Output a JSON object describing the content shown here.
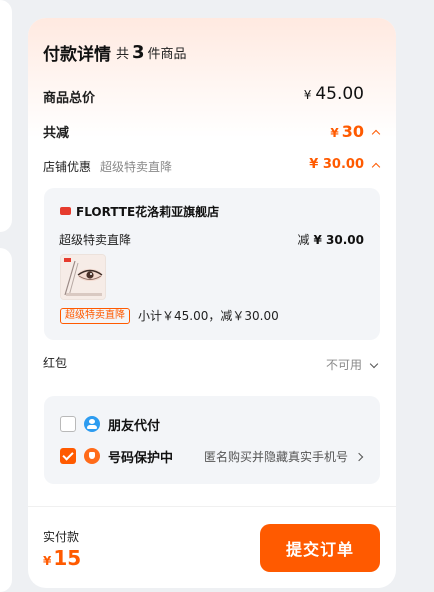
{
  "header": {
    "title": "付款详情",
    "count_prefix": "共",
    "count": "3",
    "count_suffix": "件商品"
  },
  "goods_total": {
    "label": "商品总价",
    "currency": "¥",
    "amount": "45.00"
  },
  "discount_total": {
    "label": "共减",
    "currency": "¥",
    "amount": "30"
  },
  "shop_discount": {
    "label": "店铺优惠",
    "sub": "超级特卖直降",
    "value": "¥ 30.00"
  },
  "shop": {
    "name": "FLORTTE花洛莉亚旗舰店",
    "promo_label": "超级特卖直降",
    "promo_prefix": "减",
    "promo_amount": "¥ 30.00",
    "thumbnail_icon": "eye-makeup-product-image",
    "tag": "超级特卖直降",
    "subtotal": "小计￥45.00，减￥30.00"
  },
  "red_packet": {
    "label": "红包",
    "value": "不可用"
  },
  "options": [
    {
      "label": "朋友代付",
      "checked": false,
      "icon": "friend-icon"
    },
    {
      "label": "号码保护中",
      "checked": true,
      "icon": "shield-icon",
      "hint": "匿名购买并隐藏真实手机号"
    }
  ],
  "footer": {
    "pay_label": "实付款",
    "currency": "¥",
    "amount": "15",
    "submit_label": "提交订单"
  },
  "colors": {
    "accent": "#ff5a00",
    "friend_icon": "#2d9cf0",
    "card_bg": "#ffffff",
    "page_bg": "#eef0f3"
  }
}
